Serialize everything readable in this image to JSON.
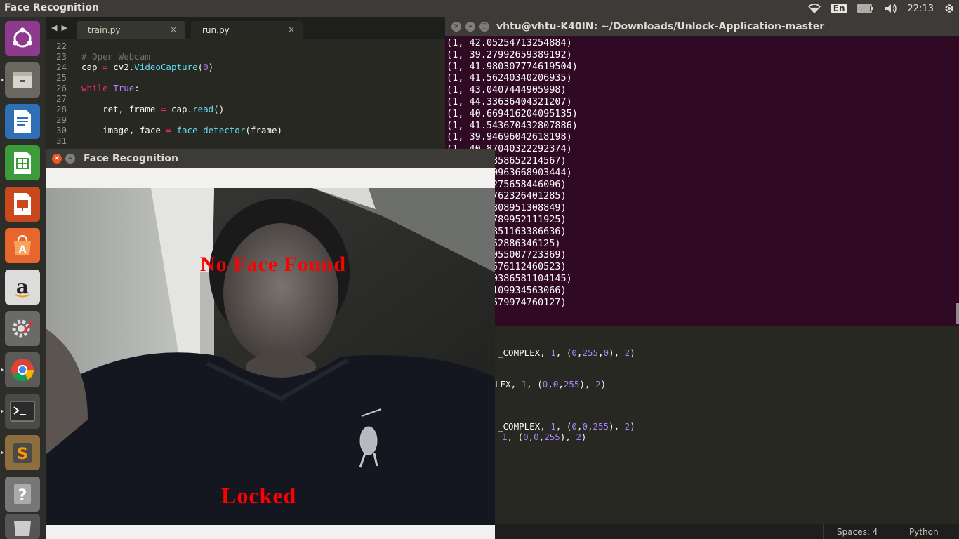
{
  "top_panel": {
    "app_title": "Face Recognition",
    "keyboard": "En",
    "time": "22:13",
    "icons": [
      "wifi-icon",
      "battery-icon",
      "volume-icon",
      "settings-gear-icon"
    ]
  },
  "launcher": {
    "items": [
      "ubuntu-dash-icon",
      "files-icon",
      "writer-icon",
      "calc-icon",
      "impress-icon",
      "software-center-icon",
      "amazon-icon",
      "system-settings-icon",
      "chrome-icon",
      "terminal-icon",
      "sublime-text-icon",
      "help-icon",
      "trash-icon"
    ]
  },
  "editor": {
    "tabs": [
      {
        "label": "train.py",
        "close": "×"
      },
      {
        "label": "run.py",
        "close": "×"
      }
    ],
    "lines": [
      {
        "n": "22",
        "text": ""
      },
      {
        "n": "23",
        "text": "# Open Webcam"
      },
      {
        "n": "24",
        "text": "cap = cv2.VideoCapture(0)"
      },
      {
        "n": "25",
        "text": ""
      },
      {
        "n": "26",
        "text": "while True:"
      },
      {
        "n": "27",
        "text": ""
      },
      {
        "n": "28",
        "text": "    ret, frame = cap.read()"
      },
      {
        "n": "29",
        "text": ""
      },
      {
        "n": "30",
        "text": "    image, face = face_detector(frame)"
      },
      {
        "n": "31",
        "text": ""
      }
    ],
    "lower_lines": [
      "_COMPLEX, 1, (0,255,0), 2)",
      "LEX, 1, (0,0,255), 2)",
      "_COMPLEX, 1, (0,0,255), 2)",
      "1, (0,0,255), 2)"
    ],
    "status": {
      "spaces": "Spaces: 4",
      "language": "Python"
    }
  },
  "terminal": {
    "title": "vhtu@vhtu-K40IN: ~/Downloads/Unlock-Application-master",
    "lines": [
      "(1, 42.05254713254884)",
      "(1, 39.27992659389192)",
      "(1, 41.980307774619504)",
      "(1, 41.56240340206935)",
      "(1, 43.0407444905998)",
      "(1, 44.33636404321207)",
      "(1, 40.669416204095135)",
      "(1, 41.543670432807886)",
      "(1, 39.94696042618198)",
      "(1, 40.87040322292374)",
      "(1, 40.0858652214567)",
      "(1, 40.40963668903444)",
      "(1, 40.6275658446096)",
      "(1, 40.5762326401285)",
      "(1, 40.2308951308849)",
      "(1, 40.1789952111925)",
      "(1, 40.7851163386636)",
      "(1, 40.452886346125)",
      "(1, 40.4055007723369)",
      "(1, 40.0576112460523)",
      "(1, 40.70386581104145)",
      "(1, 40.3109934563066)",
      "(1, 40.5579974760127)"
    ]
  },
  "cv_window": {
    "title": "Face Recognition",
    "overlay_status": "No Face Found",
    "overlay_lock": "Locked"
  }
}
